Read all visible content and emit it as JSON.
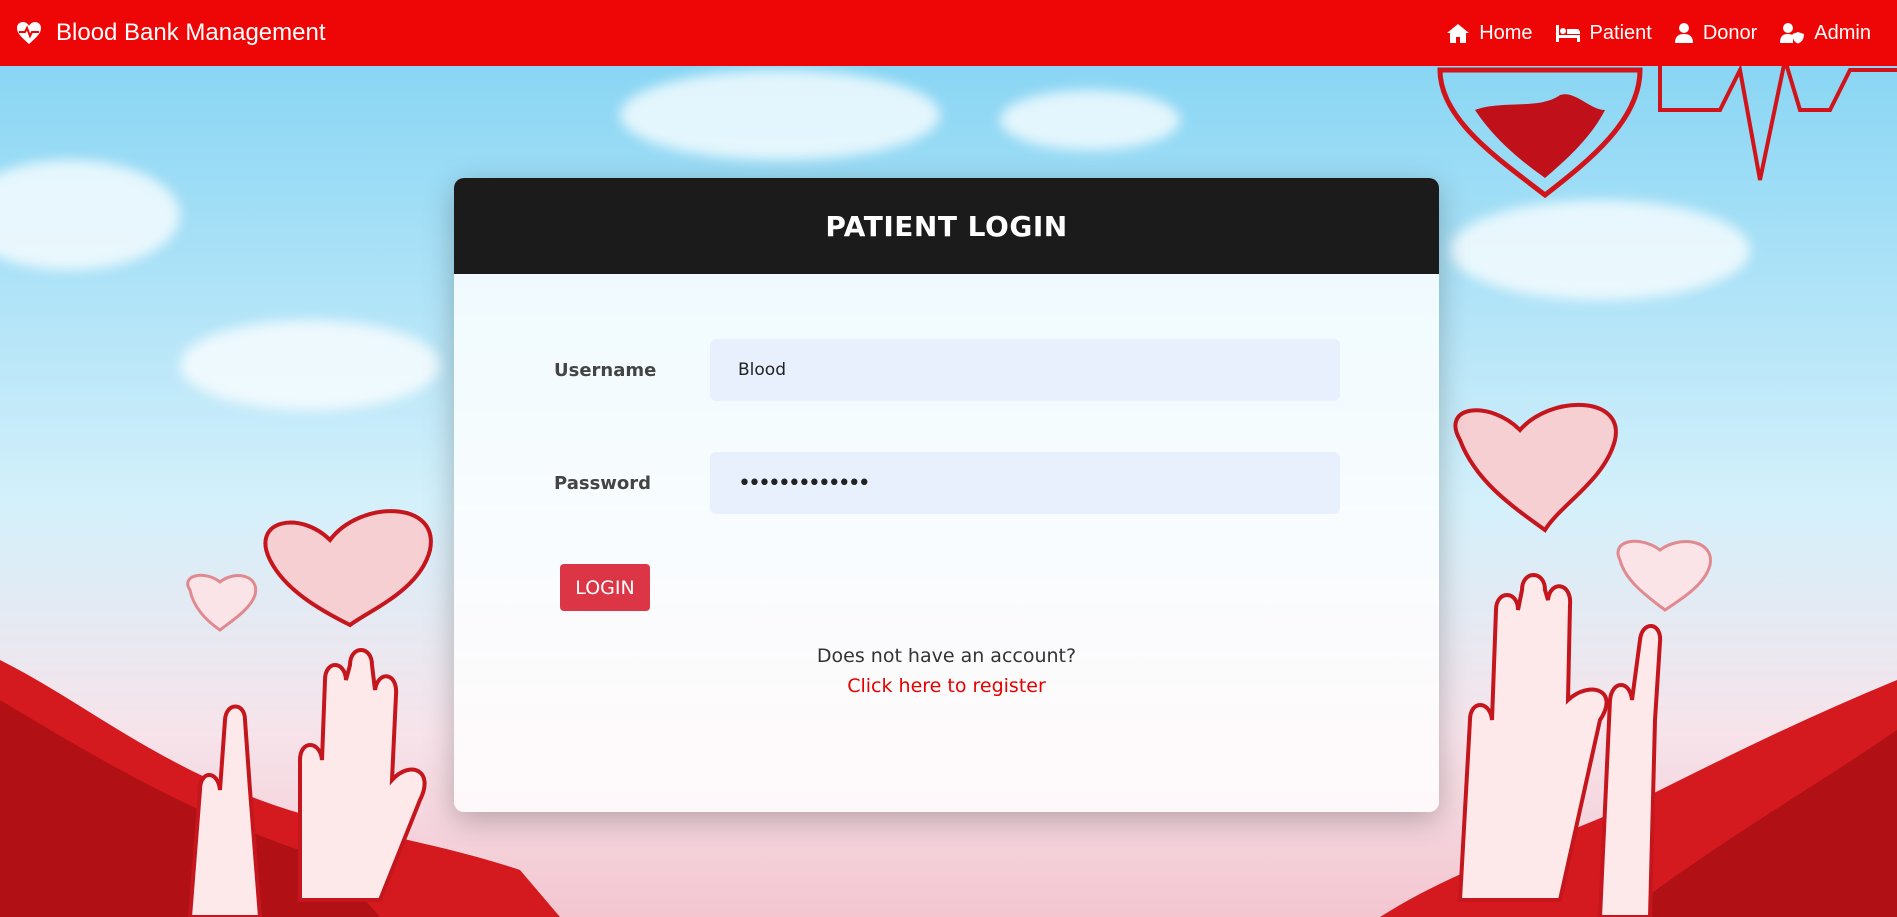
{
  "navbar": {
    "brand": "Blood Bank Management",
    "links": [
      {
        "label": "Home",
        "icon": "home-icon"
      },
      {
        "label": "Patient",
        "icon": "bed-icon"
      },
      {
        "label": "Donor",
        "icon": "user-icon"
      },
      {
        "label": "Admin",
        "icon": "user-shield-icon"
      }
    ],
    "color": "#ee0505"
  },
  "login": {
    "title": "PATIENT LOGIN",
    "username_label": "Username",
    "username_value": "Blood",
    "password_label": "Password",
    "password_value": "•••••••••••••",
    "button_label": "LOGIN",
    "register_prompt": "Does not have an account?",
    "register_link": "Click here to register"
  },
  "colors": {
    "accent": "#dc3545",
    "header_bg": "#1b1b1b",
    "input_bg": "#e8f0fe"
  }
}
